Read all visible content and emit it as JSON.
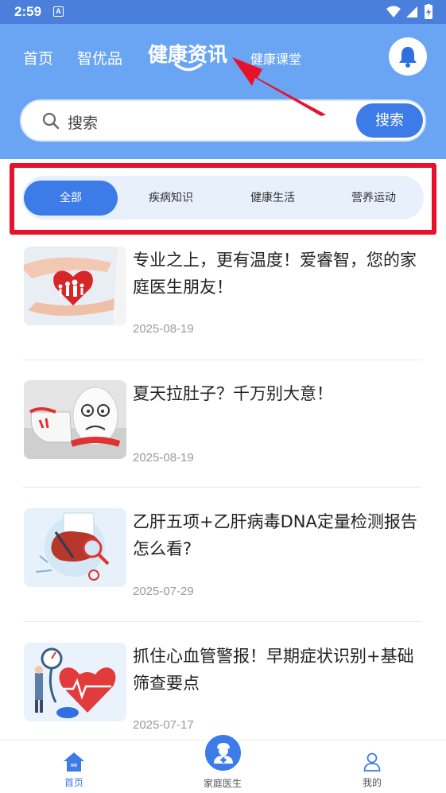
{
  "status_bar": {
    "time": "2:59",
    "notification_badge": "A"
  },
  "header": {
    "tabs": [
      {
        "label": "首页"
      },
      {
        "label": "智优品"
      },
      {
        "label": "健康资讯",
        "active": true
      },
      {
        "label": "健康课堂"
      }
    ],
    "bell_icon": "bell-icon"
  },
  "search": {
    "placeholder": "搜索",
    "button_label": "搜索"
  },
  "categories": [
    {
      "label": "全部",
      "active": true
    },
    {
      "label": "疾病知识"
    },
    {
      "label": "健康生活"
    },
    {
      "label": "营养运动"
    }
  ],
  "articles": [
    {
      "title": "专业之上，更有温度！爱睿智，您的家庭医生朋友！",
      "date": "2025-08-19"
    },
    {
      "title": "夏天拉肚子？千万别大意！",
      "date": "2025-08-19"
    },
    {
      "title": "乙肝五项+乙肝病毒DNA定量检测报告怎么看?",
      "date": "2025-07-29"
    },
    {
      "title": "抓住心血管警报！早期症状识别+基础筛查要点",
      "date": "2025-07-17"
    }
  ],
  "bottom_nav": {
    "home": {
      "label": "首页",
      "active": true
    },
    "doctor": {
      "label": "家庭医生"
    },
    "mine": {
      "label": "我的"
    }
  },
  "colors": {
    "primary": "#3c7be8",
    "header_bg": "#6aa5f4",
    "annotation_red": "#e8112b"
  }
}
